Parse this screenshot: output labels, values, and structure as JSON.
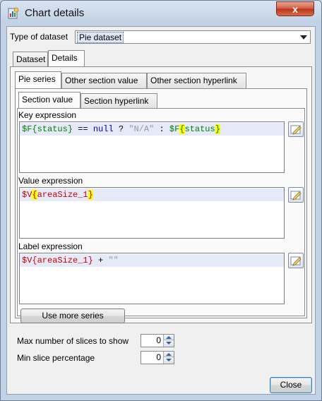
{
  "window": {
    "title": "Chart details",
    "close_glyph": "x",
    "icon": "jasper-chart-icon"
  },
  "dataset_type": {
    "label": "Type of dataset",
    "value": "Pie dataset"
  },
  "tabs": [
    "Dataset",
    "Details"
  ],
  "details_tabs": [
    "Pie series",
    "Other section value",
    "Other section hyperlink"
  ],
  "series_tabs": [
    "Section value",
    "Section hyperlink"
  ],
  "key_expression": {
    "label": "Key expression",
    "tokens": {
      "t1": "$F",
      "t2": "{",
      "t3": "status",
      "t4": "}",
      "t5": " == ",
      "t6": "null",
      "t7": " ? ",
      "t8": "\"N/A\"",
      "t9": " : ",
      "t10": "$F",
      "t11": "{",
      "t12": "status",
      "t13": "}"
    }
  },
  "value_expression": {
    "label": "Value expression",
    "tokens": {
      "t1": "$V",
      "t2": "{",
      "t3": "areaSize_1",
      "t4": "}"
    }
  },
  "label_expression": {
    "label": "Label expression",
    "tokens": {
      "t1": "$V{areaSize_1}",
      "t2": " + ",
      "t3": "\"\""
    }
  },
  "buttons": {
    "use_more_series": "Use more series",
    "close": "Close"
  },
  "max_slices": {
    "label": "Max number of slices to show",
    "value": "0"
  },
  "min_slice_percentage": {
    "label": "Min slice percentage",
    "value": "0"
  },
  "colors": {
    "field": "#008000",
    "variable": "#cc0000",
    "keyword": "#0000cc",
    "string": "#999999",
    "highlight": "#ffff00"
  }
}
